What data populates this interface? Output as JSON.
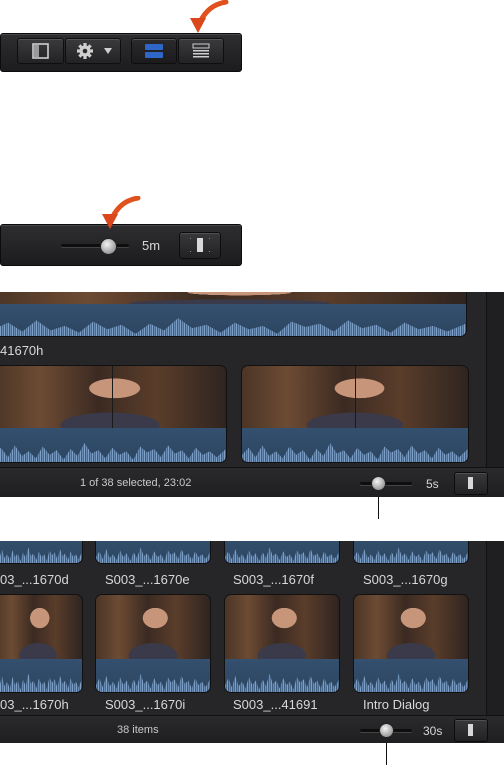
{
  "toolbar": {
    "icons": [
      "filmstrip-icon",
      "gear-icon",
      "chevron-down-icon",
      "filmstrip-view-icon",
      "list-view-icon"
    ],
    "accent": "#2f67c9"
  },
  "zoom_bar": {
    "duration": "5m"
  },
  "filmstrip_panel": {
    "top_clip_label": "41670h",
    "status": "1 of 38 selected, 23:02",
    "duration": "5s"
  },
  "grid_panel": {
    "row1_labels": [
      "03_...1670d",
      "S003_...1670e",
      "S003_...1670f",
      "S003_...1670g"
    ],
    "row2_labels": [
      "03_...1670h",
      "S003_...1670i",
      "S003_...41691",
      "Intro Dialog"
    ],
    "status": "38 items",
    "duration": "30s"
  }
}
